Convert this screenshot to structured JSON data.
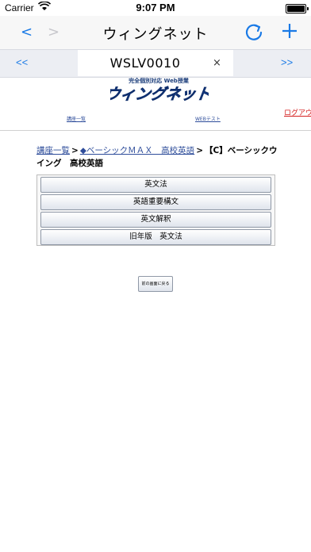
{
  "status_bar": {
    "carrier": "Carrier",
    "time": "9:07 PM"
  },
  "nav": {
    "back": "<",
    "forward": ">",
    "title": "ウィングネット",
    "reload_icon": "reload-icon",
    "add_icon": "plus-icon"
  },
  "tabs": {
    "prev": "<<",
    "next": ">>",
    "active_label": "WSLV0010",
    "close": "×"
  },
  "header": {
    "logo_sub": "完全個別対応  Web授業",
    "logo_text": "ウィングネット",
    "link_kouza": "講座一覧",
    "link_web": "WEBテスト",
    "logout": "ログアウト"
  },
  "breadcrumb": {
    "item1": "講座一覧",
    "sep": ">",
    "item2": "◆ベーシックＭＡＸ　高校英語",
    "current": "【C】ベーシックウイング　高校英語"
  },
  "menu": {
    "items": [
      "英文法",
      "英語重要構文",
      "英文解釈",
      "旧年版　英文法"
    ]
  },
  "back_button": "前の画面に戻る",
  "colors": {
    "accent": "#1a7ae6",
    "link": "#2d4c9a",
    "logout": "#d42020"
  }
}
